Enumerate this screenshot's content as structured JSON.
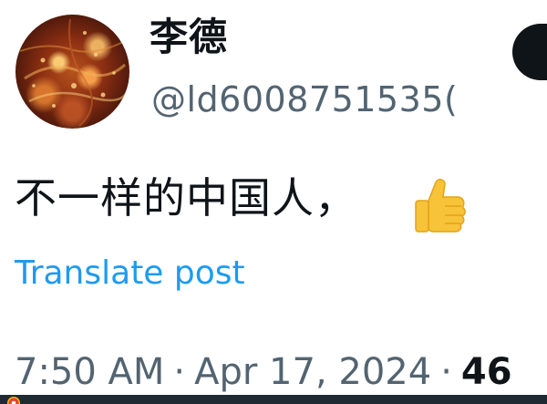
{
  "author": {
    "display_name": "李德",
    "handle": "@ld6008751535("
  },
  "post": {
    "text": "不一样的中国人，",
    "emoji_icon": "thumbs-up-icon",
    "translate_label": "Translate post"
  },
  "meta": {
    "time": "7:50 AM",
    "separator": "·",
    "date": "Apr 17, 2024",
    "views_count": "46"
  },
  "colors": {
    "text_primary": "#0f1419",
    "text_secondary": "#536471",
    "link": "#1d9bf0",
    "button_dark": "#0f1419"
  }
}
